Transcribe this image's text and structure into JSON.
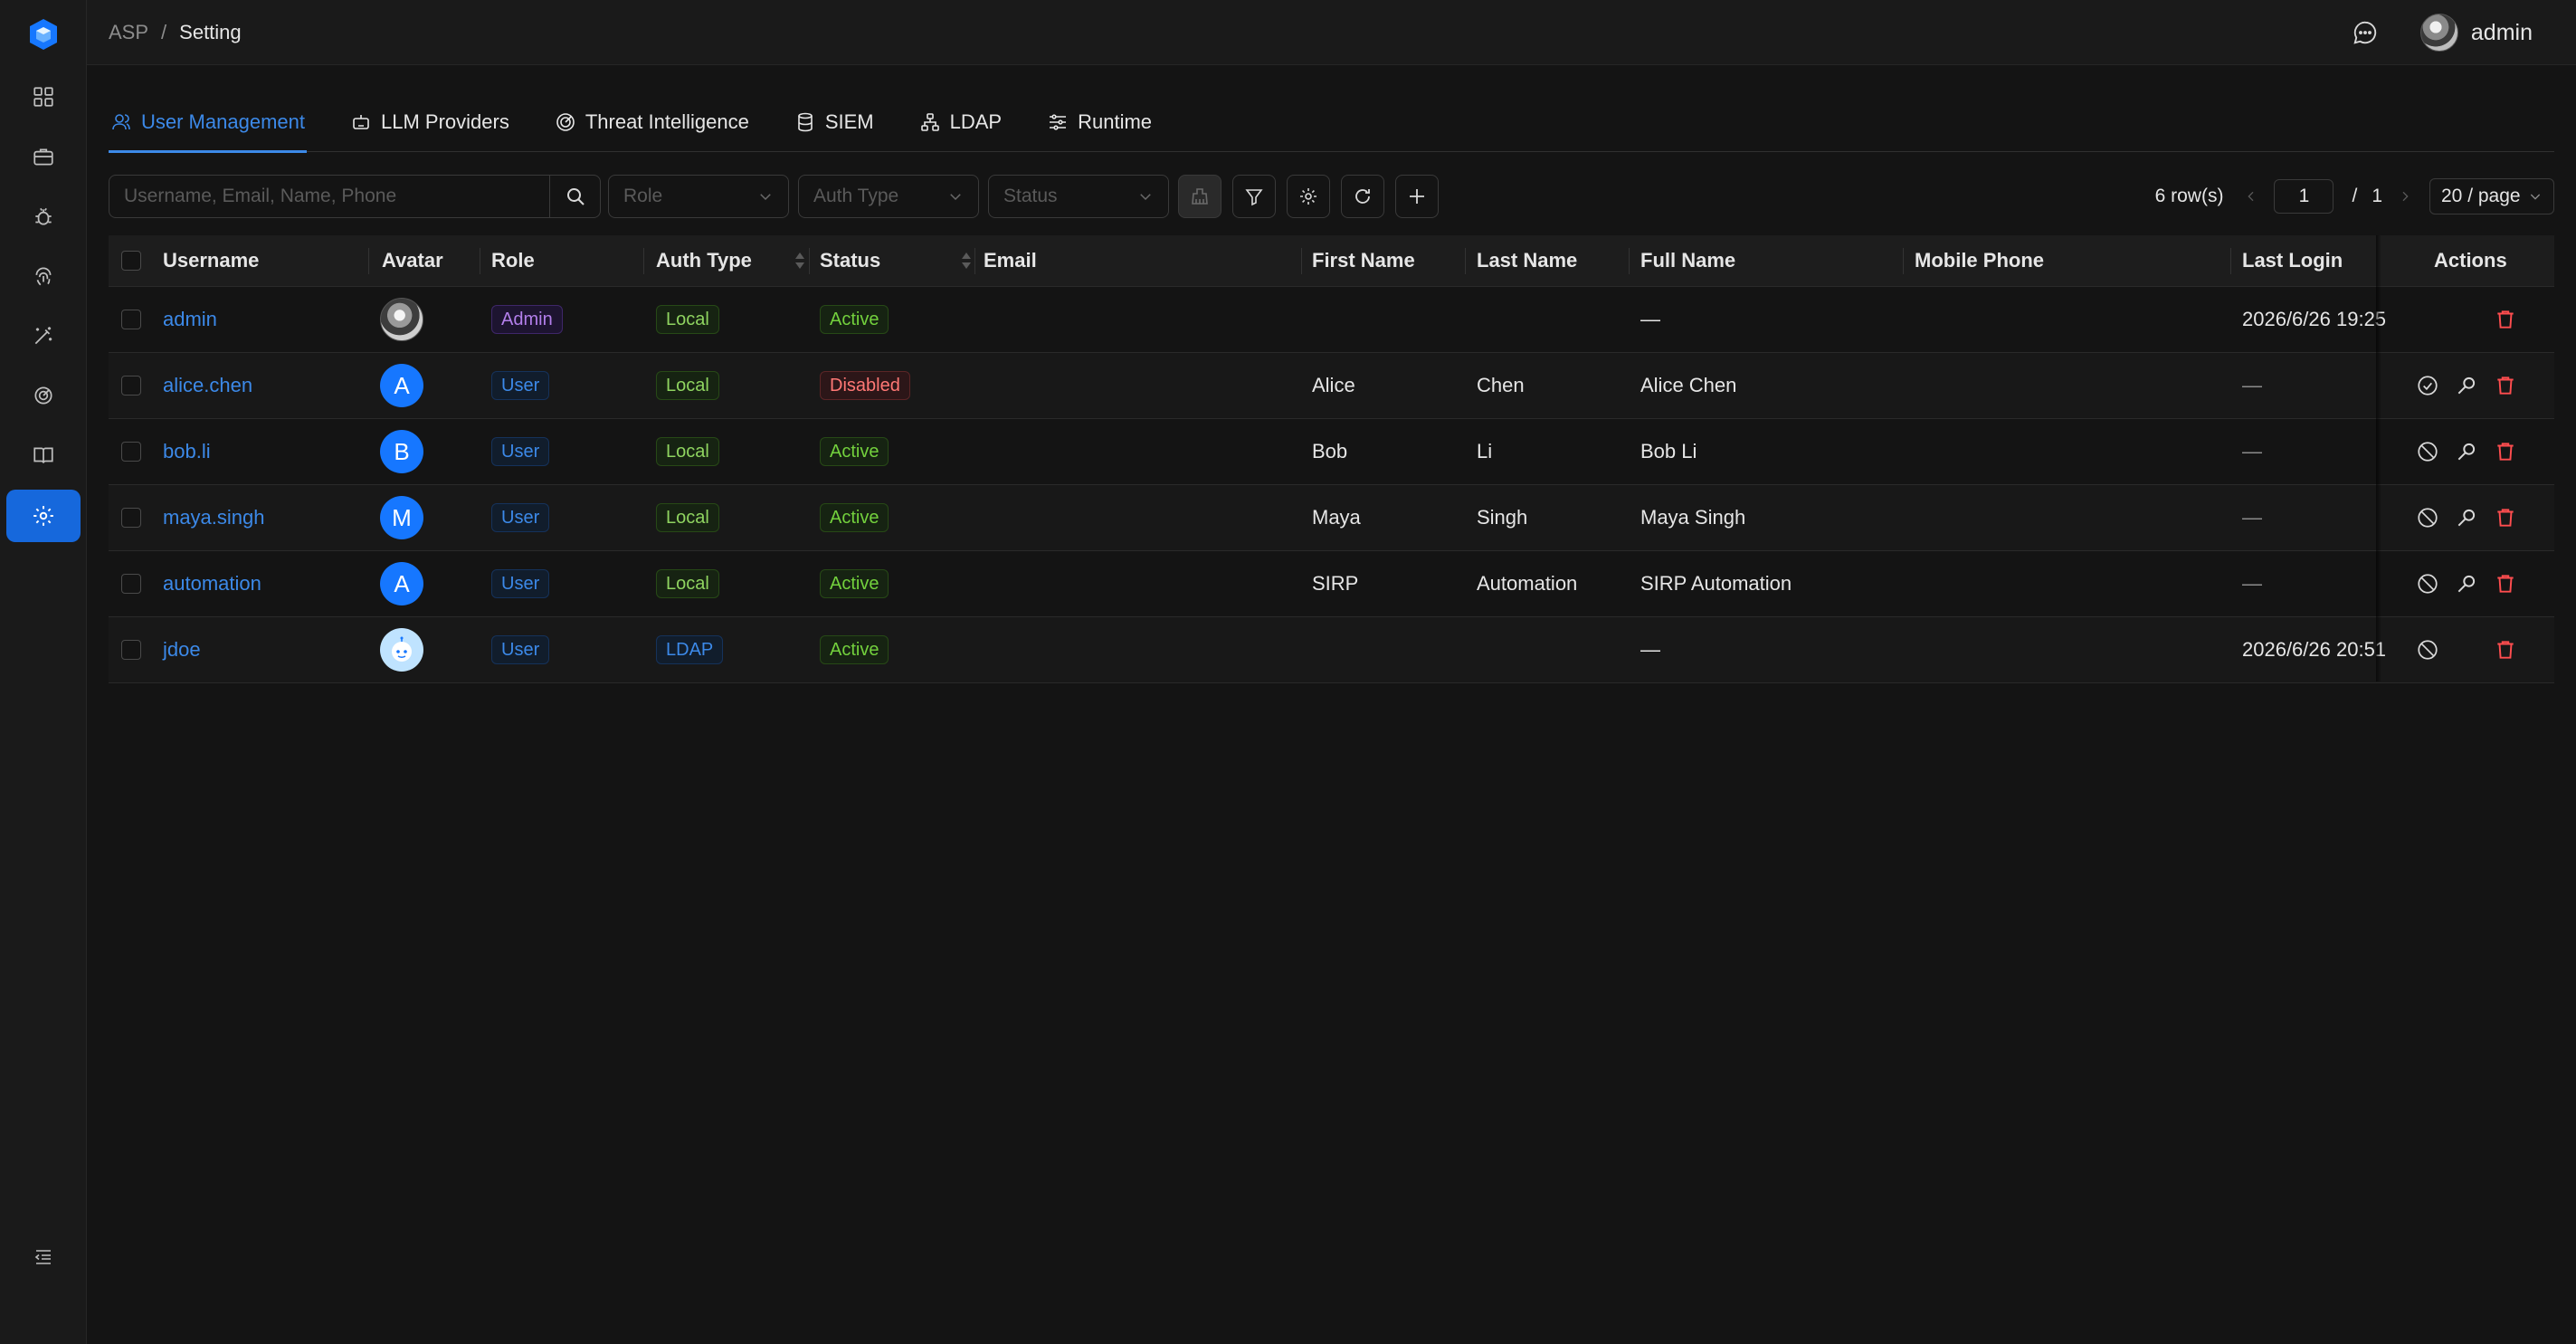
{
  "breadcrumb": {
    "root": "ASP",
    "current": "Setting"
  },
  "header": {
    "user_name": "admin"
  },
  "tabs": [
    {
      "label": "User Management",
      "icon": "user-icon",
      "active": true
    },
    {
      "label": "LLM Providers",
      "icon": "robot-icon"
    },
    {
      "label": "Threat Intelligence",
      "icon": "radar-icon"
    },
    {
      "label": "SIEM",
      "icon": "database-icon"
    },
    {
      "label": "LDAP",
      "icon": "cluster-icon"
    },
    {
      "label": "Runtime",
      "icon": "sliders-icon"
    }
  ],
  "toolbar": {
    "search_placeholder": "Username, Email, Name, Phone",
    "role_placeholder": "Role",
    "auth_type_placeholder": "Auth Type",
    "status_placeholder": "Status"
  },
  "pager": {
    "rows": "6 row(s)",
    "current_page": "1",
    "slash": "/",
    "total_pages": "1",
    "page_size": "20 / page"
  },
  "columns": {
    "username": "Username",
    "avatar": "Avatar",
    "role": "Role",
    "auth_type": "Auth Type",
    "status": "Status",
    "email": "Email",
    "first_name": "First Name",
    "last_name": "Last Name",
    "full_name": "Full Name",
    "mobile_phone": "Mobile Phone",
    "last_login": "Last Login",
    "actions": "Actions"
  },
  "users": [
    {
      "username": "admin",
      "avatar": "photo",
      "role": "Admin",
      "auth_type": "Local",
      "status": "Active",
      "email": "",
      "first_name": "",
      "last_name": "",
      "full_name": "—",
      "mobile_phone": "",
      "last_login": "2026/6/26 19:25"
    },
    {
      "username": "alice.chen",
      "avatar": "A",
      "role": "User",
      "auth_type": "Local",
      "status": "Disabled",
      "email": "",
      "first_name": "Alice",
      "last_name": "Chen",
      "full_name": "Alice Chen",
      "mobile_phone": "",
      "last_login": "—"
    },
    {
      "username": "bob.li",
      "avatar": "B",
      "role": "User",
      "auth_type": "Local",
      "status": "Active",
      "email": "",
      "first_name": "Bob",
      "last_name": "Li",
      "full_name": "Bob Li",
      "mobile_phone": "",
      "last_login": "—"
    },
    {
      "username": "maya.singh",
      "avatar": "M",
      "role": "User",
      "auth_type": "Local",
      "status": "Active",
      "email": "",
      "first_name": "Maya",
      "last_name": "Singh",
      "full_name": "Maya Singh",
      "mobile_phone": "",
      "last_login": "—"
    },
    {
      "username": "automation",
      "avatar": "A",
      "role": "User",
      "auth_type": "Local",
      "status": "Active",
      "email": "",
      "first_name": "SIRP",
      "last_name": "Automation",
      "full_name": "SIRP Automation",
      "mobile_phone": "",
      "last_login": "—"
    },
    {
      "username": "jdoe",
      "avatar": "robot",
      "role": "User",
      "auth_type": "LDAP",
      "status": "Active",
      "email": "",
      "first_name": "",
      "last_name": "",
      "full_name": "—",
      "mobile_phone": "",
      "last_login": "2026/6/26 20:51"
    }
  ],
  "colors": {
    "accent": "#1668dc",
    "link": "#3c89e8",
    "danger": "#ff4d4f",
    "success": "#73d13d"
  }
}
